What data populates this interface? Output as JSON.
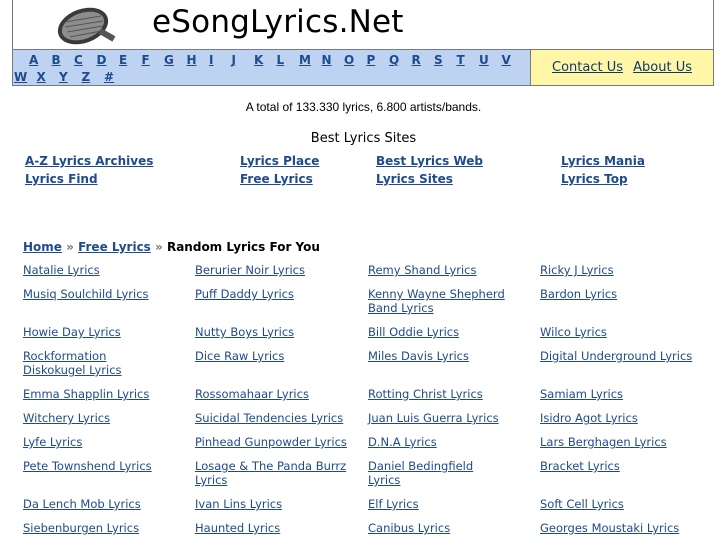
{
  "site": {
    "name": "eSongLyrics.Net"
  },
  "nav": {
    "letters": [
      "A",
      "B",
      "C",
      "D",
      "E",
      "F",
      "G",
      "H",
      "I",
      "J",
      "K",
      "L",
      "M",
      "N",
      "O",
      "P",
      "Q",
      "R",
      "S",
      "T",
      "U",
      "V",
      "W",
      "X",
      "Y",
      "Z",
      "#"
    ],
    "contact_label": "Contact Us",
    "about_label": "About Us"
  },
  "stats": {
    "total_text": "A total of 133.330 lyrics, 6.800 artists/bands."
  },
  "best_sites": {
    "title": "Best Lyrics Sites",
    "links": [
      "A-Z Lyrics Archives",
      "Lyrics Place",
      "Best Lyrics Web",
      "Lyrics Mania",
      "Lyrics Find",
      "Free Lyrics",
      "Lyrics Sites",
      "Lyrics Top"
    ]
  },
  "breadcrumb": {
    "home": "Home",
    "sep": "»",
    "free": "Free Lyrics",
    "current": "Random Lyrics For You"
  },
  "random_lyrics": [
    "Natalie Lyrics",
    "Berurier Noir Lyrics",
    "Remy Shand Lyrics",
    "Ricky J Lyrics",
    "Musiq Soulchild Lyrics",
    "Puff Daddy Lyrics",
    "Kenny Wayne Shepherd Band Lyrics",
    "Bardon Lyrics",
    "Howie Day Lyrics",
    "Nutty Boys Lyrics",
    "Bill Oddie Lyrics",
    "Wilco Lyrics",
    "Rockformation Diskokugel Lyrics",
    "Dice Raw Lyrics",
    "Miles Davis Lyrics",
    "Digital Underground Lyrics",
    "Emma Shapplin Lyrics",
    "Rossomahaar Lyrics",
    "Rotting Christ Lyrics",
    "Samiam Lyrics",
    "Witchery Lyrics",
    "Suicidal Tendencies Lyrics",
    "Juan Luis Guerra Lyrics",
    "Isidro Agot Lyrics",
    "Lyfe Lyrics",
    "Pinhead Gunpowder Lyrics",
    "D.N.A Lyrics",
    "Lars Berghagen Lyrics",
    "Pete Townshend Lyrics",
    "Losage & The Panda Burrz Lyrics",
    "Daniel Bedingfield Lyrics",
    "Bracket Lyrics",
    "Da Lench Mob Lyrics",
    "Ivan Lins Lyrics",
    "Elf Lyrics",
    "Soft Cell Lyrics",
    "Siebenburgen Lyrics",
    "Haunted Lyrics",
    "Canibus Lyrics",
    "Georges Moustaki Lyrics"
  ]
}
